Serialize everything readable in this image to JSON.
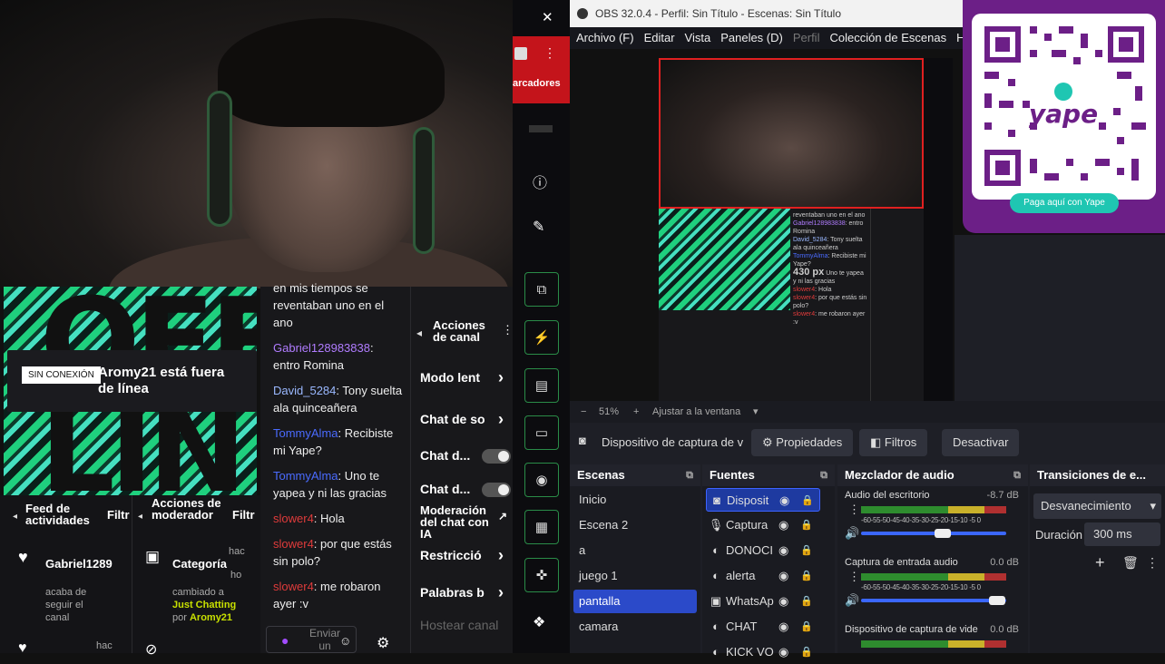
{
  "stream": {
    "offline_badge": "SIN CONEXIÓN",
    "offline_title": "Aromy21 está fuera de línea",
    "offline_banner_text": "OFF LIN",
    "feed_title": "Feed de actividades",
    "feed_filter": "Filtr",
    "feed_user": "Gabriel1289",
    "feed_event": "acaba de seguir el canal",
    "feed_time": "hac",
    "mod_title": "Acciones de moderador",
    "mod_filter": "Filtr",
    "mod_item": "Categoría",
    "mod_time": "hac",
    "mod_time2": "ho",
    "mod_event_pre": "cambiado a",
    "mod_event_game": "Just Chatting",
    "mod_event_by": "por",
    "mod_event_user": "Aromy21"
  },
  "chat": {
    "partial": "en mis tiempos se reventaban uno en el ano",
    "messages": [
      {
        "user": "Gabriel128983838",
        "color": "#b07cff",
        "text": "entro Romina"
      },
      {
        "user": "David_5284",
        "color": "#9ab8ff",
        "text": "Tony suelta ala quinceañera"
      },
      {
        "user": "TommyAlma",
        "color": "#4a6bff",
        "text": "Recibiste mi Yape?"
      },
      {
        "user": "TommyAlma",
        "color": "#4a6bff",
        "text": "Uno te yapea y ni las gracias"
      },
      {
        "user": "slower4",
        "color": "#e03b3b",
        "text": "Hola"
      },
      {
        "user": "slower4",
        "color": "#e03b3b",
        "text": "por que estás sin polo?"
      },
      {
        "user": "slower4",
        "color": "#e03b3b",
        "text": "me robaron ayer :v"
      }
    ],
    "send_label": "Enviar un"
  },
  "chat_settings": {
    "title": "Acciones de canal",
    "items": [
      "Modo lent",
      "Chat de so",
      "Chat d...",
      "Chat d...",
      "Moderación del chat con IA",
      "Restricció",
      "Palabras b",
      "Hostear canal"
    ]
  },
  "sidebar_top": {
    "marcadores": "arcadores"
  },
  "obs": {
    "title": "OBS 32.0.4 - Perfil: Sin Título - Escenas: Sin Título",
    "menu": [
      "Archivo (F)",
      "Editar",
      "Vista",
      "Paneles (D)",
      "Perfil",
      "Colección de Escenas",
      "He"
    ],
    "zoom": "51%",
    "fit": "Ajustar a la ventana",
    "source_name": "Dispositivo de captura de v",
    "properties": "Propiedades",
    "filters": "Filtros",
    "deactivate": "Desactivar",
    "scenes_title": "Escenas",
    "scenes": [
      "Inicio",
      "Escena 2",
      "a",
      "juego 1",
      "pantalla",
      "camara"
    ],
    "selected_scene": "pantalla",
    "sources_title": "Fuentes",
    "sources": [
      {
        "name": "Disposit",
        "icon": "camera-icon"
      },
      {
        "name": "Captura",
        "icon": "mic-icon"
      },
      {
        "name": "DONOCI",
        "icon": "globe-icon"
      },
      {
        "name": "alerta",
        "icon": "globe-icon"
      },
      {
        "name": "WhatsAp",
        "icon": "window-icon"
      },
      {
        "name": "CHAT",
        "icon": "globe-icon"
      },
      {
        "name": "KICK VO",
        "icon": "globe-icon"
      }
    ],
    "mixer_title": "Mezclador de audio",
    "mixer": [
      {
        "name": "Audio del escritorio",
        "db": "-8.7 dB",
        "level": 0.6
      },
      {
        "name": "Captura de entrada audio",
        "db": "0.0 dB",
        "level": 1.0
      },
      {
        "name": "Dispositivo de captura de vide",
        "db": "0.0 dB",
        "level": 0.7
      }
    ],
    "meter_scale": "-60-55-50-45-40-35-30-25-20-15-10 -5  0",
    "transitions_title": "Transiciones de e...",
    "transition": "Desvanecimiento",
    "duration_label": "Duración",
    "duration_value": "300 ms"
  },
  "yape": {
    "brand": "yape",
    "pay_label": "Paga aquí con Yape"
  },
  "colors": {
    "accent_green": "#2a8c48",
    "obs_blue": "#2b4ac9",
    "yape_purple": "#6c1f87"
  }
}
